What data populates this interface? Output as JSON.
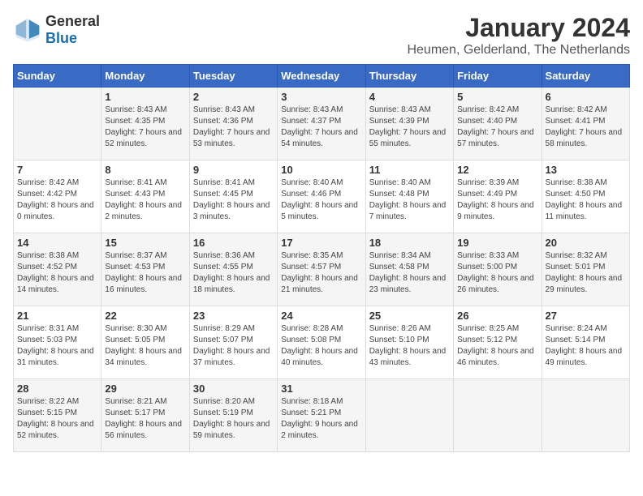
{
  "header": {
    "logo_general": "General",
    "logo_blue": "Blue",
    "title": "January 2024",
    "subtitle": "Heumen, Gelderland, The Netherlands"
  },
  "calendar": {
    "days_of_week": [
      "Sunday",
      "Monday",
      "Tuesday",
      "Wednesday",
      "Thursday",
      "Friday",
      "Saturday"
    ],
    "weeks": [
      [
        {
          "day": "",
          "sunrise": "",
          "sunset": "",
          "daylight": ""
        },
        {
          "day": "1",
          "sunrise": "Sunrise: 8:43 AM",
          "sunset": "Sunset: 4:35 PM",
          "daylight": "Daylight: 7 hours and 52 minutes."
        },
        {
          "day": "2",
          "sunrise": "Sunrise: 8:43 AM",
          "sunset": "Sunset: 4:36 PM",
          "daylight": "Daylight: 7 hours and 53 minutes."
        },
        {
          "day": "3",
          "sunrise": "Sunrise: 8:43 AM",
          "sunset": "Sunset: 4:37 PM",
          "daylight": "Daylight: 7 hours and 54 minutes."
        },
        {
          "day": "4",
          "sunrise": "Sunrise: 8:43 AM",
          "sunset": "Sunset: 4:39 PM",
          "daylight": "Daylight: 7 hours and 55 minutes."
        },
        {
          "day": "5",
          "sunrise": "Sunrise: 8:42 AM",
          "sunset": "Sunset: 4:40 PM",
          "daylight": "Daylight: 7 hours and 57 minutes."
        },
        {
          "day": "6",
          "sunrise": "Sunrise: 8:42 AM",
          "sunset": "Sunset: 4:41 PM",
          "daylight": "Daylight: 7 hours and 58 minutes."
        }
      ],
      [
        {
          "day": "7",
          "sunrise": "Sunrise: 8:42 AM",
          "sunset": "Sunset: 4:42 PM",
          "daylight": "Daylight: 8 hours and 0 minutes."
        },
        {
          "day": "8",
          "sunrise": "Sunrise: 8:41 AM",
          "sunset": "Sunset: 4:43 PM",
          "daylight": "Daylight: 8 hours and 2 minutes."
        },
        {
          "day": "9",
          "sunrise": "Sunrise: 8:41 AM",
          "sunset": "Sunset: 4:45 PM",
          "daylight": "Daylight: 8 hours and 3 minutes."
        },
        {
          "day": "10",
          "sunrise": "Sunrise: 8:40 AM",
          "sunset": "Sunset: 4:46 PM",
          "daylight": "Daylight: 8 hours and 5 minutes."
        },
        {
          "day": "11",
          "sunrise": "Sunrise: 8:40 AM",
          "sunset": "Sunset: 4:48 PM",
          "daylight": "Daylight: 8 hours and 7 minutes."
        },
        {
          "day": "12",
          "sunrise": "Sunrise: 8:39 AM",
          "sunset": "Sunset: 4:49 PM",
          "daylight": "Daylight: 8 hours and 9 minutes."
        },
        {
          "day": "13",
          "sunrise": "Sunrise: 8:38 AM",
          "sunset": "Sunset: 4:50 PM",
          "daylight": "Daylight: 8 hours and 11 minutes."
        }
      ],
      [
        {
          "day": "14",
          "sunrise": "Sunrise: 8:38 AM",
          "sunset": "Sunset: 4:52 PM",
          "daylight": "Daylight: 8 hours and 14 minutes."
        },
        {
          "day": "15",
          "sunrise": "Sunrise: 8:37 AM",
          "sunset": "Sunset: 4:53 PM",
          "daylight": "Daylight: 8 hours and 16 minutes."
        },
        {
          "day": "16",
          "sunrise": "Sunrise: 8:36 AM",
          "sunset": "Sunset: 4:55 PM",
          "daylight": "Daylight: 8 hours and 18 minutes."
        },
        {
          "day": "17",
          "sunrise": "Sunrise: 8:35 AM",
          "sunset": "Sunset: 4:57 PM",
          "daylight": "Daylight: 8 hours and 21 minutes."
        },
        {
          "day": "18",
          "sunrise": "Sunrise: 8:34 AM",
          "sunset": "Sunset: 4:58 PM",
          "daylight": "Daylight: 8 hours and 23 minutes."
        },
        {
          "day": "19",
          "sunrise": "Sunrise: 8:33 AM",
          "sunset": "Sunset: 5:00 PM",
          "daylight": "Daylight: 8 hours and 26 minutes."
        },
        {
          "day": "20",
          "sunrise": "Sunrise: 8:32 AM",
          "sunset": "Sunset: 5:01 PM",
          "daylight": "Daylight: 8 hours and 29 minutes."
        }
      ],
      [
        {
          "day": "21",
          "sunrise": "Sunrise: 8:31 AM",
          "sunset": "Sunset: 5:03 PM",
          "daylight": "Daylight: 8 hours and 31 minutes."
        },
        {
          "day": "22",
          "sunrise": "Sunrise: 8:30 AM",
          "sunset": "Sunset: 5:05 PM",
          "daylight": "Daylight: 8 hours and 34 minutes."
        },
        {
          "day": "23",
          "sunrise": "Sunrise: 8:29 AM",
          "sunset": "Sunset: 5:07 PM",
          "daylight": "Daylight: 8 hours and 37 minutes."
        },
        {
          "day": "24",
          "sunrise": "Sunrise: 8:28 AM",
          "sunset": "Sunset: 5:08 PM",
          "daylight": "Daylight: 8 hours and 40 minutes."
        },
        {
          "day": "25",
          "sunrise": "Sunrise: 8:26 AM",
          "sunset": "Sunset: 5:10 PM",
          "daylight": "Daylight: 8 hours and 43 minutes."
        },
        {
          "day": "26",
          "sunrise": "Sunrise: 8:25 AM",
          "sunset": "Sunset: 5:12 PM",
          "daylight": "Daylight: 8 hours and 46 minutes."
        },
        {
          "day": "27",
          "sunrise": "Sunrise: 8:24 AM",
          "sunset": "Sunset: 5:14 PM",
          "daylight": "Daylight: 8 hours and 49 minutes."
        }
      ],
      [
        {
          "day": "28",
          "sunrise": "Sunrise: 8:22 AM",
          "sunset": "Sunset: 5:15 PM",
          "daylight": "Daylight: 8 hours and 52 minutes."
        },
        {
          "day": "29",
          "sunrise": "Sunrise: 8:21 AM",
          "sunset": "Sunset: 5:17 PM",
          "daylight": "Daylight: 8 hours and 56 minutes."
        },
        {
          "day": "30",
          "sunrise": "Sunrise: 8:20 AM",
          "sunset": "Sunset: 5:19 PM",
          "daylight": "Daylight: 8 hours and 59 minutes."
        },
        {
          "day": "31",
          "sunrise": "Sunrise: 8:18 AM",
          "sunset": "Sunset: 5:21 PM",
          "daylight": "Daylight: 9 hours and 2 minutes."
        },
        {
          "day": "",
          "sunrise": "",
          "sunset": "",
          "daylight": ""
        },
        {
          "day": "",
          "sunrise": "",
          "sunset": "",
          "daylight": ""
        },
        {
          "day": "",
          "sunrise": "",
          "sunset": "",
          "daylight": ""
        }
      ]
    ]
  }
}
